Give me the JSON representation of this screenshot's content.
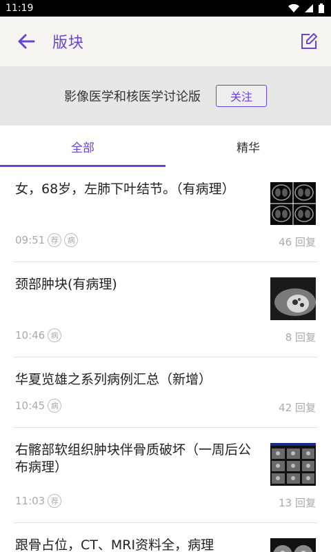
{
  "status_bar": {
    "time": "11:19"
  },
  "app_bar": {
    "title": "版块"
  },
  "forum": {
    "name": "影像医学和核医学讨论版",
    "follow_label": "关注"
  },
  "tabs": [
    {
      "label": "全部"
    },
    {
      "label": "精华"
    }
  ],
  "posts": [
    {
      "title": "女，68岁，左肺下叶结节。（有病理）",
      "time": "09:51",
      "badges": [
        "荐",
        "病"
      ],
      "replies": "46 回复"
    },
    {
      "title": "颈部肿块(有病理)",
      "time": "10:46",
      "badges": [
        "病"
      ],
      "replies": "8 回复"
    },
    {
      "title": "华夏览雄之系列病例汇总（新增）",
      "time": "10:45",
      "badges": [
        "病"
      ],
      "replies": "42 回复"
    },
    {
      "title": "右髂部软组织肿块伴骨质破坏（一周后公布病理）",
      "time": "11:03",
      "badges": [
        "荐"
      ],
      "replies": "13 回复"
    },
    {
      "title": "跟骨占位，CT、MRI资料全，病理"
    }
  ],
  "colors": {
    "accent": "#6a43d6",
    "appbar_bg": "#f5f4f0",
    "banner_bg": "#e7e7e7"
  }
}
